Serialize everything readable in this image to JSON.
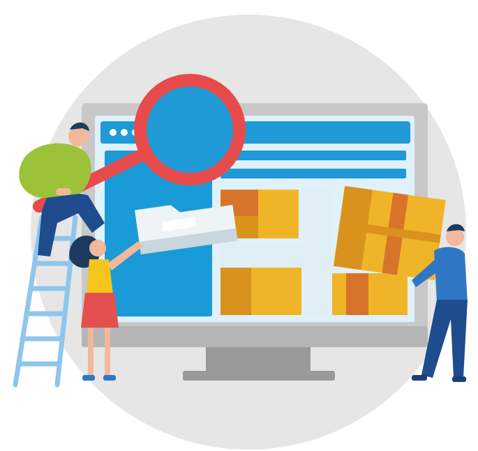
{
  "illustration": {
    "subject": "website-content-search",
    "palette": {
      "background_circle": "#e6e6e6",
      "monitor_frame": "#c8c8c8",
      "monitor_stand": "#9a9a9a",
      "screen_header": "#1f9ad6",
      "screen_body": "#dff1fb",
      "sidebar_panel": "#1a9ad6",
      "magnifier_ring": "#e84b4b",
      "magnifier_lens": "#1f9ad6",
      "box_gold": "#f0b429",
      "box_gold_dark": "#d9921c",
      "box_orange": "#d8742a",
      "folder": "#eef3f6",
      "shirt_green": "#9cc23a",
      "shirt_blue": "#2f77c4",
      "shirt_yellow": "#f3c51d",
      "skirt_red": "#e45050",
      "trousers_navy": "#1f4c8c",
      "ladder": "#8ec6ec",
      "skin": "#f2b89a",
      "hair_dark": "#1e3a5f"
    },
    "icons": [
      "magnifier-icon",
      "folder-icon",
      "window-dot-icon"
    ]
  }
}
